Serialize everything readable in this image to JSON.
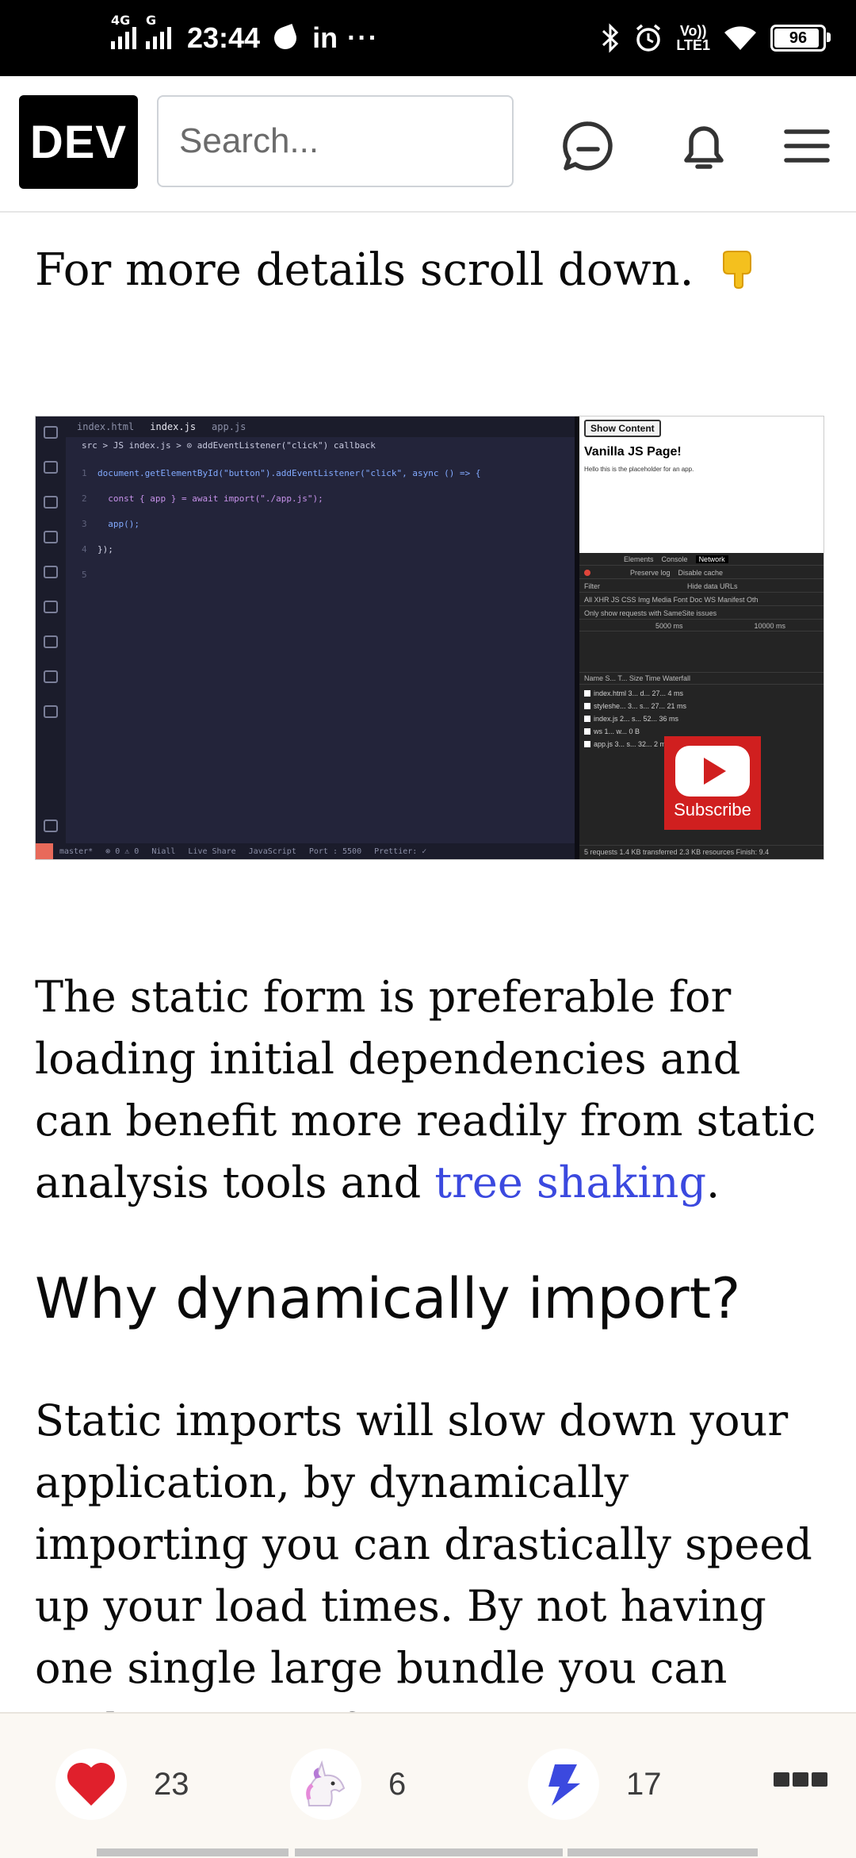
{
  "status_bar": {
    "network_1": "4G",
    "network_2": "G",
    "time": "23:44",
    "app_indicator": "in",
    "more": "···",
    "volte_top": "Vo))",
    "volte_bottom": "LTE1",
    "battery": "96",
    "icons": [
      "leaf-icon",
      "bluetooth-icon",
      "alarm-icon",
      "wifi-icon",
      "battery-icon"
    ]
  },
  "header": {
    "logo": "DEV",
    "search_placeholder": "Search...",
    "icons": [
      "chat-icon",
      "notification-bell-icon",
      "hamburger-menu-icon"
    ]
  },
  "article": {
    "intro": "For more details scroll down.",
    "screenshot": {
      "editor_tabs": [
        "index.html",
        "index.js",
        "app.js"
      ],
      "breadcrumb": "src > JS index.js > ⊙ addEventListener(\"click\") callback",
      "code_lines": [
        "document.getElementById(\"button\").addEventListener(\"click\", async () => {",
        "  const { app } = await import(\"./app.js\");",
        "  app();",
        "});",
        ""
      ],
      "status_items": [
        "master*",
        "⊗ 0 ⚠ 0",
        "Niall",
        "Live Share",
        "JavaScript",
        "Port : 5500",
        "Prettier: ✓"
      ],
      "browser_button": "Show Content",
      "browser_title": "Vanilla JS Page!",
      "browser_text": "Hello this is the placeholder for an app.",
      "devtools_tabs": [
        "Elements",
        "Console",
        "Network"
      ],
      "devtools_filters": [
        "Preserve log",
        "Disable cache"
      ],
      "devtools_types": "All  XHR  JS  CSS  Img  Media  Font  Doc  WS  Manifest  Oth",
      "devtools_samesite": "Only show requests with SameSite issues",
      "devtools_hide": "Hide data URLs",
      "devtools_filter_placeholder": "Filter",
      "timeline": [
        "5000 ms",
        "10000 ms"
      ],
      "columns": "Name   S...  T...  Size   Time   Waterfall",
      "requests": [
        "index.html   3...  d...  27...   4 ms",
        "styleshe...  3...  s...  27...  21 ms",
        "index.js     2...  s...  52...  36 ms",
        "ws           1...  w...   0 B",
        "app.js       3...  s...  32...   2 ms"
      ],
      "summary": "5 requests   1.4 KB transferred   2.3 KB resources   Finish: 9.4",
      "subscribe": "Subscribe"
    },
    "paragraph_1_before_link": "The static form is preferable for loading initial dependencies and can benefit more readily from static analysis tools and ",
    "paragraph_1_link": "tree shaking",
    "paragraph_1_after_link": ".",
    "heading": "Why dynamically import?",
    "paragraph_2": "Static imports will slow down your application, by dynamically importing you can drastically speed up your load times. By not having one single large bundle you can archive crazy fast"
  },
  "reactions": {
    "likes": "23",
    "unicorns": "6",
    "bookmarks": "17",
    "icons": [
      "heart-icon",
      "unicorn-icon",
      "bookmark-icon",
      "more-icon"
    ],
    "colors": {
      "heart": "#e0202c",
      "bookmark": "#3b49df"
    }
  },
  "colors": {
    "link": "#3b49df",
    "header_bg": "#ffffff",
    "status_bar_bg": "#000000"
  }
}
